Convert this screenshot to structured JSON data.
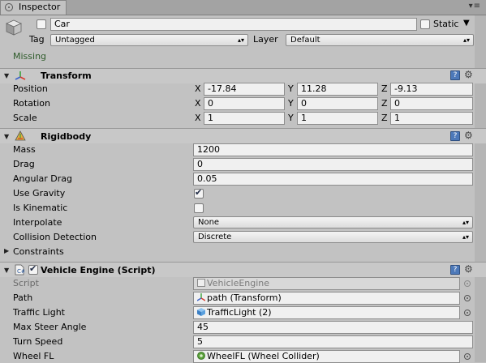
{
  "tab": {
    "title": "Inspector"
  },
  "header": {
    "name": "Car",
    "static_label": "Static",
    "tag_label": "Tag",
    "tag_value": "Untagged",
    "layer_label": "Layer",
    "layer_value": "Default",
    "missing_text": "Missing"
  },
  "transform": {
    "title": "Transform",
    "rows": [
      {
        "label": "Position",
        "x": "-17.84",
        "y": "11.28",
        "z": "-9.13"
      },
      {
        "label": "Rotation",
        "x": "0",
        "y": "0",
        "z": "0"
      },
      {
        "label": "Scale",
        "x": "1",
        "y": "1",
        "z": "1"
      }
    ],
    "axes": {
      "x": "X",
      "y": "Y",
      "z": "Z"
    }
  },
  "rigidbody": {
    "title": "Rigidbody",
    "mass_label": "Mass",
    "mass": "1200",
    "drag_label": "Drag",
    "drag": "0",
    "angular_drag_label": "Angular Drag",
    "angular_drag": "0.05",
    "use_gravity_label": "Use Gravity",
    "use_gravity": true,
    "is_kinematic_label": "Is Kinematic",
    "is_kinematic": false,
    "interpolate_label": "Interpolate",
    "interpolate": "None",
    "collision_label": "Collision Detection",
    "collision": "Discrete",
    "constraints_label": "Constraints"
  },
  "vehicle_engine": {
    "title": "Vehicle Engine (Script)",
    "script_label": "Script",
    "script": "VehicleEngine",
    "path_label": "Path",
    "path": "path (Transform)",
    "traffic_light_label": "Traffic Light",
    "traffic_light": "TrafficLight (2)",
    "max_steer_label": "Max Steer Angle",
    "max_steer": "45",
    "turn_speed_label": "Turn Speed",
    "turn_speed": "5",
    "wheel_fl_label": "Wheel FL",
    "wheel_fl": "WheelFL (Wheel Collider)"
  },
  "icons": {
    "help": "help-icon",
    "gear": "gear-icon"
  }
}
